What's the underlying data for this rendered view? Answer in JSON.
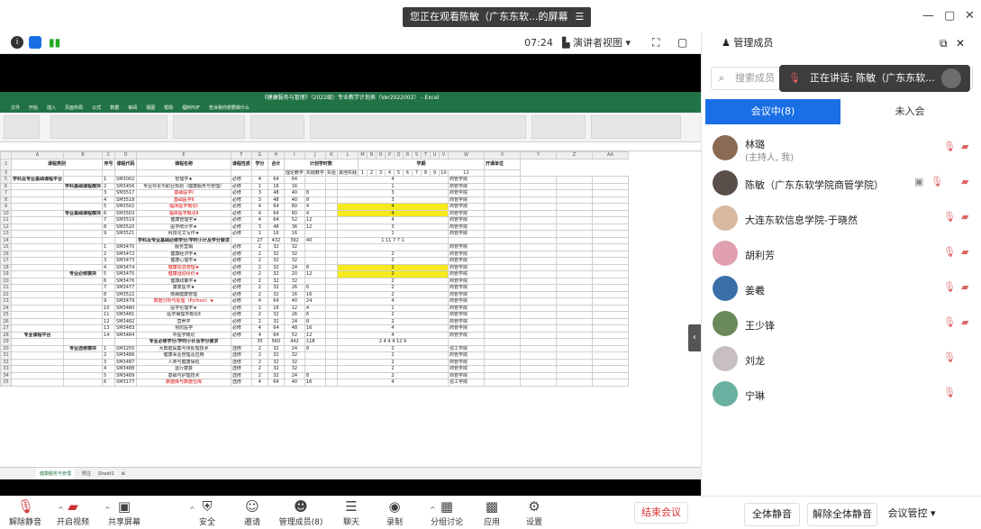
{
  "window": {
    "share_banner": "您正在观看陈敏（广东东软...的屏幕",
    "banner_menu_icon": "menu-icon",
    "minimize": "—",
    "restore": "▢",
    "close": "✕"
  },
  "toolbar": {
    "time": "07:24",
    "presenter_view": "演讲者视图",
    "presenter_caret": "▾"
  },
  "excel": {
    "title": "《健康服务与管理》（2022级）专业教学计划表（Ver2022002） - Excel",
    "menu": [
      "文件",
      "开始",
      "插入",
      "页面布局",
      "公式",
      "数据",
      "审阅",
      "视图",
      "帮助",
      "福昕PDF",
      "告诉我你想要做什么"
    ],
    "sheet_tabs": [
      "健康服务与管理",
      "附注",
      "Sheet1",
      "⊕"
    ],
    "col_headers": [
      "A",
      "B",
      "C",
      "D",
      "E",
      "F",
      "G",
      "H",
      "I",
      "J",
      "K",
      "L",
      "M",
      "N",
      "O",
      "P",
      "Q",
      "R",
      "S",
      "T",
      "U",
      "V",
      "W",
      "X",
      "Y",
      "Z",
      "AA",
      "AB"
    ],
    "header1": [
      "课程类别",
      "序号",
      "课程代码",
      "课程名称",
      "课程性质",
      "学分",
      "合计",
      "计划学时数",
      "学期",
      "开课单位"
    ],
    "header_sub": [
      "理论教学",
      "实践教学",
      "实验",
      "其他实践",
      "第一学年",
      "第二学年",
      "第三学年",
      "第四学年"
    ],
    "semesters": [
      "1",
      "2",
      "3",
      "4",
      "5",
      "6",
      "7",
      "8",
      "9",
      "10",
      "11"
    ],
    "rows": [
      {
        "n": "5",
        "seq": "1",
        "code": "SM3002",
        "name": "管理学★",
        "type": "必修",
        "credit": "4",
        "total": "64",
        "theory": "64",
        "exp": "",
        "other": "",
        "s": "4",
        "unit": "商管学院",
        "red": false
      },
      {
        "n": "6",
        "seq": "2",
        "code": "SM3456",
        "name": "专业导论与职业规划（健康服务与管理）",
        "type": "必修",
        "credit": "1",
        "total": "16",
        "theory": "16",
        "exp": "",
        "other": "",
        "s": "1",
        "unit": "商管学院",
        "red": false
      },
      {
        "n": "7",
        "seq": "3",
        "code": "SM3517",
        "name": "基础医学Ⅰ",
        "type": "必修",
        "credit": "3",
        "total": "48",
        "theory": "40",
        "exp": "8",
        "other": "",
        "s": "3",
        "unit": "商管学院",
        "red": true
      },
      {
        "n": "8",
        "seq": "4",
        "code": "SM3518",
        "name": "基础医学Ⅱ",
        "type": "必修",
        "credit": "3",
        "total": "48",
        "theory": "40",
        "exp": "8",
        "other": "",
        "s": "3",
        "unit": "商管学院",
        "red": true
      },
      {
        "n": "9",
        "seq": "5",
        "code": "SM3502",
        "name": "临床医学概论Ⅰ",
        "type": "必修",
        "credit": "4",
        "total": "64",
        "theory": "60",
        "exp": "4",
        "other": "",
        "s": "4",
        "unit": "商管学院",
        "red": true
      },
      {
        "n": "10",
        "seq": "6",
        "code": "SM3503",
        "name": "临床医学概论Ⅱ",
        "type": "必修",
        "credit": "4",
        "total": "64",
        "theory": "60",
        "exp": "4",
        "other": "",
        "s": "4",
        "unit": "商管学院",
        "red": true
      },
      {
        "n": "11",
        "seq": "7",
        "code": "SM3519",
        "name": "健康管理学★",
        "type": "必修",
        "credit": "4",
        "total": "64",
        "theory": "52",
        "exp": "12",
        "other": "",
        "s": "4",
        "unit": "商管学院",
        "red": false
      },
      {
        "n": "12",
        "seq": "8",
        "code": "SM3520",
        "name": "医学统计学★",
        "type": "必修",
        "credit": "3",
        "total": "48",
        "theory": "36",
        "exp": "12",
        "other": "",
        "s": "3",
        "unit": "商管学院",
        "red": false
      },
      {
        "n": "13",
        "seq": "9",
        "code": "SM3521",
        "name": "科技论文写作★",
        "type": "必修",
        "credit": "1",
        "total": "16",
        "theory": "16",
        "exp": "",
        "other": "",
        "s": "1",
        "unit": "商管学院",
        "red": false
      },
      {
        "n": "14",
        "seq": "",
        "code": "",
        "name": "学科及专业基础必修学分/学时小计及学分要求",
        "type": "",
        "credit": "27",
        "total": "432",
        "theory": "392",
        "exp": "40",
        "other": "",
        "s": "1  11  7  7  1",
        "unit": "",
        "red": false
      },
      {
        "n": "15",
        "seq": "1",
        "code": "SM3470",
        "name": "服务营销",
        "type": "必修",
        "credit": "2",
        "total": "32",
        "theory": "32",
        "exp": "",
        "other": "",
        "s": "",
        "unit": "商管学院",
        "red": false
      },
      {
        "n": "16",
        "seq": "2",
        "code": "SM3472",
        "name": "健康经济学★",
        "type": "必修",
        "credit": "2",
        "total": "32",
        "theory": "32",
        "exp": "",
        "other": "",
        "s": "2",
        "unit": "商管学院",
        "red": false
      },
      {
        "n": "17",
        "seq": "3",
        "code": "SM3473",
        "name": "健康心理学★",
        "type": "必修",
        "credit": "2",
        "total": "32",
        "theory": "32",
        "exp": "",
        "other": "",
        "s": "2",
        "unit": "商管学院",
        "red": false
      },
      {
        "n": "18",
        "seq": "4",
        "code": "SM3474",
        "name": "健康信息管理★",
        "type": "必修",
        "credit": "2",
        "total": "32",
        "theory": "24",
        "exp": "8",
        "other": "",
        "s": "2",
        "unit": "商管学院",
        "red": true
      },
      {
        "n": "19",
        "seq": "5",
        "code": "SM3475",
        "name": "健康运动评价★",
        "type": "必修",
        "credit": "2",
        "total": "32",
        "theory": "20",
        "exp": "12",
        "other": "",
        "s": "2",
        "unit": "商管学院",
        "red": true
      },
      {
        "n": "20",
        "seq": "6",
        "code": "SM3476",
        "name": "健康政策学★",
        "type": "必修",
        "credit": "2",
        "total": "32",
        "theory": "32",
        "exp": "",
        "other": "",
        "s": "2",
        "unit": "商管学院",
        "red": false
      },
      {
        "n": "21",
        "seq": "7",
        "code": "SM3477",
        "name": "康复医学★",
        "type": "必修",
        "credit": "2",
        "total": "32",
        "theory": "26",
        "exp": "6",
        "other": "",
        "s": "2",
        "unit": "商管学院",
        "red": false
      },
      {
        "n": "22",
        "seq": "8",
        "code": "SM3522",
        "name": "慢病健康管理",
        "type": "必修",
        "credit": "2",
        "total": "32",
        "theory": "16",
        "exp": "16",
        "other": "",
        "s": "2",
        "unit": "商管学院",
        "red": false
      },
      {
        "n": "23",
        "seq": "9",
        "code": "SM3479",
        "name": "数据分析与处理（Python）★",
        "type": "必修",
        "credit": "4",
        "total": "64",
        "theory": "40",
        "exp": "24",
        "other": "",
        "s": "4",
        "unit": "商管学院",
        "red": true
      },
      {
        "n": "24",
        "seq": "10",
        "code": "SM3480",
        "name": "医学伦理学★",
        "type": "必修",
        "credit": "1",
        "total": "16",
        "theory": "12",
        "exp": "4",
        "other": "",
        "s": "1",
        "unit": "商管学院",
        "red": false
      },
      {
        "n": "25",
        "seq": "11",
        "code": "SM3481",
        "name": "医学病理学概论Ⅱ",
        "type": "必修",
        "credit": "2",
        "total": "32",
        "theory": "26",
        "exp": "6",
        "other": "",
        "s": "2",
        "unit": "商管学院",
        "red": false
      },
      {
        "n": "26",
        "seq": "12",
        "code": "SM3482",
        "name": "营养学",
        "type": "必修",
        "credit": "2",
        "total": "32",
        "theory": "24",
        "exp": "8",
        "other": "",
        "s": "2",
        "unit": "商管学院",
        "red": false
      },
      {
        "n": "27",
        "seq": "13",
        "code": "SM3483",
        "name": "预防医学",
        "type": "必修",
        "credit": "4",
        "total": "64",
        "theory": "48",
        "exp": "16",
        "other": "",
        "s": "4",
        "unit": "商管学院",
        "red": false
      },
      {
        "n": "28",
        "seq": "14",
        "code": "SM3484",
        "name": "中医学概论",
        "type": "必修",
        "credit": "4",
        "total": "64",
        "theory": "52",
        "exp": "12",
        "other": "",
        "s": "4",
        "unit": "商管学院",
        "red": false
      },
      {
        "n": "29",
        "seq": "",
        "code": "",
        "name": "专业必修学分/学时小计及学分要求",
        "type": "",
        "credit": "35",
        "total": "560",
        "theory": "442",
        "exp": "118",
        "other": "",
        "s": "2  4  4  4  12  9",
        "unit": "",
        "red": false
      },
      {
        "n": "30",
        "seq": "1",
        "code": "SM3255",
        "name": "大数据采集与预处理技术",
        "type": "选修",
        "credit": "2",
        "total": "32",
        "theory": "24",
        "exp": "8",
        "other": "",
        "s": "2",
        "unit": "信工学院",
        "red": false
      },
      {
        "n": "31",
        "seq": "2",
        "code": "SM3486",
        "name": "健康事业管理及应用",
        "type": "选修",
        "credit": "2",
        "total": "32",
        "theory": "32",
        "exp": "",
        "other": "",
        "s": "2",
        "unit": "商管学院",
        "red": false
      },
      {
        "n": "32",
        "seq": "3",
        "code": "SM3487",
        "name": "人类与健康保险",
        "type": "选修",
        "credit": "2",
        "total": "32",
        "theory": "32",
        "exp": "",
        "other": "",
        "s": "2",
        "unit": "商管学院",
        "red": false
      },
      {
        "n": "33",
        "seq": "4",
        "code": "SM3488",
        "name": "运行康复",
        "type": "选修",
        "credit": "2",
        "total": "32",
        "theory": "32",
        "exp": "",
        "other": "",
        "s": "2",
        "unit": "商管学院",
        "red": false
      },
      {
        "n": "34",
        "seq": "5",
        "code": "SM3489",
        "name": "基础与护理技术",
        "type": "选修",
        "credit": "2",
        "total": "32",
        "theory": "24",
        "exp": "8",
        "other": "",
        "s": "2",
        "unit": "商管学院",
        "red": false
      },
      {
        "n": "35",
        "seq": "6",
        "code": "SM3177",
        "name": "数据库与数据仓库",
        "type": "选修",
        "credit": "4",
        "total": "64",
        "theory": "40",
        "exp": "16",
        "other": "",
        "s": "4",
        "unit": "信工学院",
        "red": true
      }
    ],
    "group_labels": [
      "学科及专业基础课程平台",
      "学科基础课程模块",
      "专业基础课程模块",
      "专业必修模块",
      "专业课程平台",
      "专业选修模块"
    ]
  },
  "panel": {
    "title": "管理成员",
    "search_placeholder": "搜索成员",
    "speaking": "正在讲话: 陈敏（广东东软...",
    "tab_in": "会议中(8)",
    "tab_out": "未入会",
    "members": [
      {
        "name": "林璐",
        "sub": "(主持人, 我)",
        "avatar": "#8a6a52"
      },
      {
        "name": "陈敏（广东东软学院商管学院）",
        "sub": "",
        "avatar": "#5a4e4a"
      },
      {
        "name": "大连东软信息学院-于晓然",
        "sub": "",
        "avatar": "#d9b9a0"
      },
      {
        "name": "胡利芳",
        "sub": "",
        "avatar": "#e0a0b0"
      },
      {
        "name": "姜羲",
        "sub": "",
        "avatar": "#3a6fa8"
      },
      {
        "name": "王少锋",
        "sub": "",
        "avatar": "#6a8a5a"
      },
      {
        "name": "刘龙",
        "sub": "",
        "avatar": "#c8c0c0"
      },
      {
        "name": "宁琳",
        "sub": "",
        "avatar": "#6ab0a0"
      }
    ],
    "mute_all": "全体静音",
    "unmute_all": "解除全体静音",
    "meeting_control": "会议管控"
  },
  "bottom": {
    "items": [
      {
        "label": "解除静音",
        "icon": "mic-muted-icon",
        "glyph": "🎙"
      },
      {
        "label": "开启视频",
        "icon": "video-off-icon",
        "glyph": "▰"
      },
      {
        "label": "共享屏幕",
        "icon": "share-screen-icon",
        "glyph": "▣"
      },
      {
        "label": "安全",
        "icon": "shield-icon",
        "glyph": "⛨"
      },
      {
        "label": "邀请",
        "icon": "invite-icon",
        "glyph": "☺"
      },
      {
        "label": "管理成员(8)",
        "icon": "members-icon",
        "glyph": "☻"
      },
      {
        "label": "聊天",
        "icon": "chat-icon",
        "glyph": "☰"
      },
      {
        "label": "录制",
        "icon": "record-icon",
        "glyph": "◉"
      },
      {
        "label": "分组讨论",
        "icon": "breakout-icon",
        "glyph": "▦"
      },
      {
        "label": "应用",
        "icon": "apps-icon",
        "glyph": "▩"
      },
      {
        "label": "设置",
        "icon": "gear-icon",
        "glyph": "⚙"
      }
    ],
    "end_meeting": "结束会议"
  },
  "colors": {
    "accent": "#1a6fe6",
    "excel_green": "#217346",
    "highlight": "#f6e91c",
    "danger": "#d33333"
  }
}
